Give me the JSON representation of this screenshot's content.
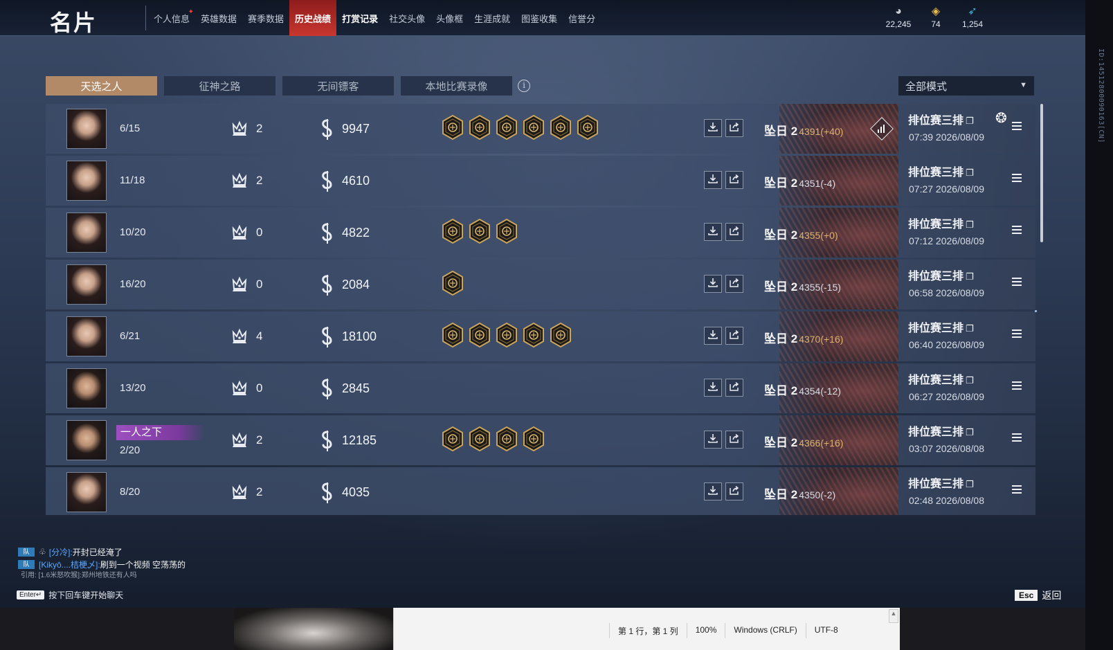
{
  "header": {
    "title": "名片",
    "nav": [
      {
        "label": "个人信息",
        "state": "normal",
        "badge": "✦"
      },
      {
        "label": "英雄数据",
        "state": "normal"
      },
      {
        "label": "赛季数据",
        "state": "normal"
      },
      {
        "label": "历史战绩",
        "state": "active"
      },
      {
        "label": "打赏记录",
        "state": "bold"
      },
      {
        "label": "社交头像",
        "state": "normal"
      },
      {
        "label": "头像框",
        "state": "normal"
      },
      {
        "label": "生涯成就",
        "state": "normal"
      },
      {
        "label": "图鉴收集",
        "state": "normal"
      },
      {
        "label": "信誉分",
        "state": "normal"
      }
    ],
    "currencies": [
      {
        "icon": "eye-coin-icon",
        "value": "22,245",
        "color": "#c8cdd6"
      },
      {
        "icon": "gold-ingot-icon",
        "value": "74",
        "color": "#e9b84a"
      },
      {
        "icon": "blue-feather-icon",
        "value": "1,254",
        "color": "#3fb8d8"
      }
    ]
  },
  "tabs": [
    {
      "label": "天选之人",
      "active": true
    },
    {
      "label": "征神之路",
      "active": false
    },
    {
      "label": "无间镖客",
      "active": false
    },
    {
      "label": "本地比赛录像",
      "active": false
    }
  ],
  "mode_select": {
    "value": "全部模式"
  },
  "side_id": "ID:1451280009016​3[CN]",
  "matches": [
    {
      "avatar": "female",
      "kd": "6/15",
      "crowns": "2",
      "score": "9947",
      "medals": 6,
      "rank_label": "坠日 2",
      "rank_value": "4391(+40)",
      "rank_gain": true,
      "mvp": true,
      "mode": "排位赛三排",
      "time": "07:39  2026/08/09"
    },
    {
      "avatar": "female",
      "kd": "11/18",
      "crowns": "2",
      "score": "4610",
      "medals": 0,
      "rank_label": "坠日 2",
      "rank_value": "4351(-4)",
      "rank_gain": false,
      "mvp": false,
      "mode": "排位赛三排",
      "time": "07:27  2026/08/09"
    },
    {
      "avatar": "female",
      "kd": "10/20",
      "crowns": "0",
      "score": "4822",
      "medals": 3,
      "rank_label": "坠日 2",
      "rank_value": "4355(+0)",
      "rank_gain": true,
      "mvp": false,
      "mode": "排位赛三排",
      "time": "07:12  2026/08/09"
    },
    {
      "avatar": "female",
      "kd": "16/20",
      "crowns": "0",
      "score": "2084",
      "medals": 1,
      "rank_label": "坠日 2",
      "rank_value": "4355(-15)",
      "rank_gain": false,
      "mvp": false,
      "mode": "排位赛三排",
      "time": "06:58  2026/08/09"
    },
    {
      "avatar": "female",
      "kd": "6/21",
      "crowns": "4",
      "score": "18100",
      "medals": 5,
      "rank_label": "坠日 2",
      "rank_value": "4370(+16)",
      "rank_gain": true,
      "mvp": false,
      "mode": "排位赛三排",
      "time": "06:40  2026/08/09"
    },
    {
      "avatar": "male",
      "kd": "13/20",
      "crowns": "0",
      "score": "2845",
      "medals": 0,
      "rank_label": "坠日 2",
      "rank_value": "4354(-12)",
      "rank_gain": false,
      "mvp": false,
      "mode": "排位赛三排",
      "time": "06:27  2026/08/09"
    },
    {
      "avatar": "male",
      "kd": "2/20",
      "crowns": "2",
      "score": "12185",
      "medals": 4,
      "rank_label": "坠日 2",
      "rank_value": "4366(+16)",
      "rank_gain": true,
      "mvp": false,
      "mode": "排位赛三排",
      "time": "03:07  2026/08/08",
      "title_badge": "一人之下"
    },
    {
      "avatar": "female2",
      "kd": "8/20",
      "crowns": "2",
      "score": "4035",
      "medals": 0,
      "rank_label": "坠日 2",
      "rank_value": "4350(-2)",
      "rank_gain": false,
      "mvp": false,
      "mode": "排位赛三排",
      "time": "02:48  2026/08/08"
    }
  ],
  "chat": {
    "lines": [
      {
        "tag": "队",
        "channel": "[分冷]:",
        "message": "开封已经淹了"
      },
      {
        "tag": "队",
        "channel": "[Kikyō....桔梗乄]:",
        "message": "刷到一个视频 空荡荡的"
      }
    ],
    "quote": "引用:  [1.6米怒吹猴]:郑州地铁还有人吗",
    "enter_key": "Enter↵",
    "enter_hint": "按下回车键开始聊天"
  },
  "esc": {
    "key": "Esc",
    "label": "返回"
  },
  "editor_status": [
    "第 1 行，第 1 列",
    "100%",
    "Windows (CRLF)",
    "UTF-8"
  ],
  "colors": {
    "accent_tab": "#b38a68",
    "active_nav": "#c9362f",
    "rank_gain": "#e0b36a",
    "title_badge": "#9d4fbf"
  }
}
